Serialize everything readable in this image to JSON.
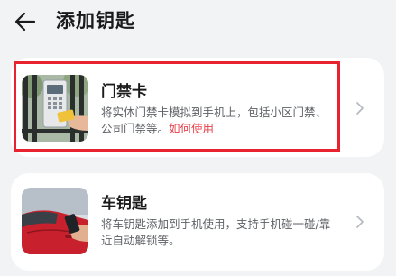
{
  "header": {
    "back_icon": "arrow-left-icon",
    "title": "添加钥匙"
  },
  "cards": [
    {
      "title": "门禁卡",
      "description": "将实体门禁卡模拟到手机上，包括小区门禁、公司门禁等。",
      "link": "如何使用",
      "thumbnail": "access-card-reader-photo",
      "chevron_icon": "chevron-right-icon"
    },
    {
      "title": "车钥匙",
      "description": "将车钥匙添加到手机使用，支持手机碰一碰/靠近自动解锁等。",
      "thumbnail": "red-car-phone-photo",
      "chevron_icon": "chevron-right-icon"
    }
  ],
  "colors": {
    "background": "#f1f3f5",
    "card": "#ffffff",
    "link": "#e8404a",
    "highlight_border": "#e8222e",
    "secondary_text": "#5e6166"
  }
}
